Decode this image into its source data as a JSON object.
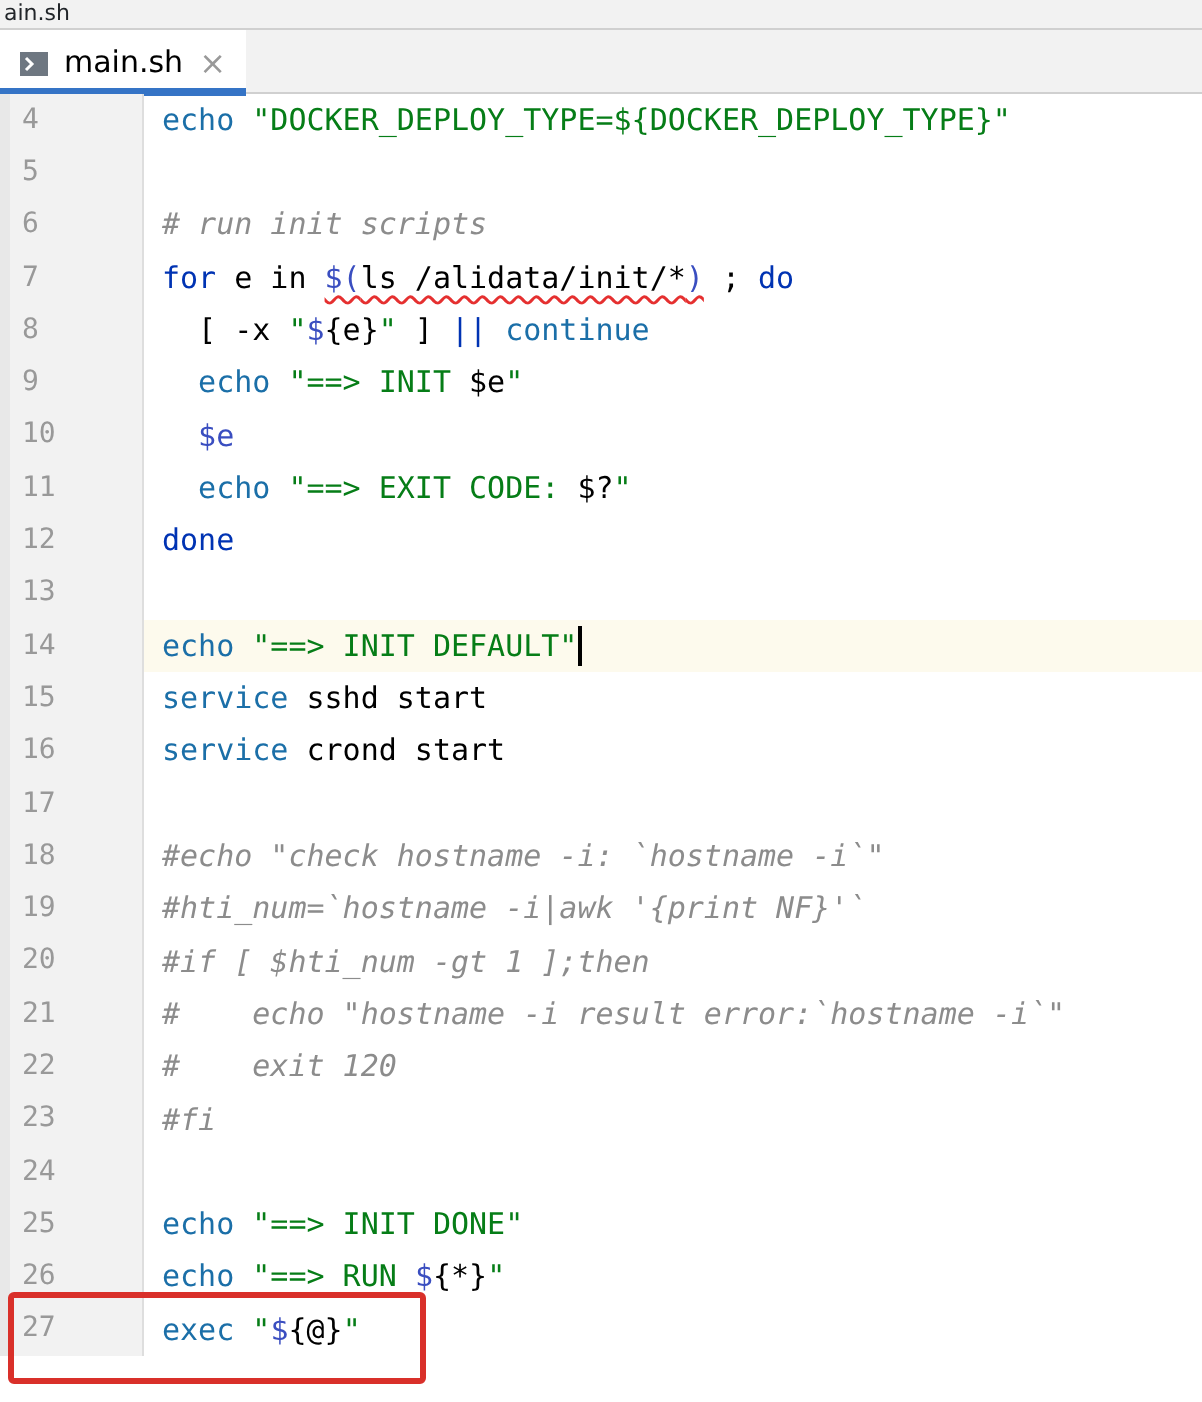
{
  "window": {
    "title": "ain.sh"
  },
  "tabs": [
    {
      "label": "main.sh",
      "selected": true,
      "close": "×"
    }
  ],
  "editor": {
    "lines": [
      {
        "number": "4",
        "tokens": [
          {
            "kind": "command",
            "text": "echo"
          },
          {
            "kind": "string",
            "text": " \"DOCKER_DEPLOY_TYPE=${DOCKER_DEPLOY_TYPE}\""
          }
        ]
      },
      {
        "number": "5"
      },
      {
        "number": "6",
        "tokens": [
          {
            "kind": "comment",
            "text": "# run init scripts"
          }
        ]
      },
      {
        "number": "7",
        "tokens": [
          {
            "kind": "keyword",
            "text": "for"
          },
          {
            "kind": "plain",
            "text": " e in "
          },
          {
            "kind": "subst",
            "text": "$(ls /alidata/init/*)",
            "underline": true
          },
          {
            "kind": "plain",
            "text": " ; "
          },
          {
            "kind": "keyword",
            "text": "do"
          }
        ]
      },
      {
        "number": "8",
        "indented": true,
        "tokens": [
          {
            "kind": "plain",
            "text": "[ -x "
          },
          {
            "kind": "string",
            "text": "\""
          },
          {
            "kind": "variable",
            "text": "$"
          },
          {
            "kind": "plain",
            "text": "{e}"
          },
          {
            "kind": "string",
            "text": "\""
          },
          {
            "kind": "plain",
            "text": " ] "
          },
          {
            "kind": "keyword",
            "text": "||"
          },
          {
            "kind": "command",
            "text": " continue"
          }
        ]
      },
      {
        "number": "9",
        "indented": true,
        "tokens": [
          {
            "kind": "command",
            "text": "echo"
          },
          {
            "kind": "string",
            "text": " \"==> INIT "
          },
          {
            "kind": "plain",
            "text": "$e"
          },
          {
            "kind": "string",
            "text": "\""
          }
        ]
      },
      {
        "number": "10",
        "indented": true,
        "tokens": [
          {
            "kind": "variable",
            "text": "$e"
          }
        ]
      },
      {
        "number": "11",
        "indented": true,
        "tokens": [
          {
            "kind": "command",
            "text": "echo"
          },
          {
            "kind": "string",
            "text": " \"==> EXIT CODE: "
          },
          {
            "kind": "plain",
            "text": "$?"
          },
          {
            "kind": "string",
            "text": "\""
          }
        ]
      },
      {
        "number": "12",
        "tokens": [
          {
            "kind": "keyword",
            "text": "done"
          }
        ]
      },
      {
        "number": "13"
      },
      {
        "number": "14",
        "current": true,
        "tokens": [
          {
            "kind": "command",
            "text": "echo"
          },
          {
            "kind": "string",
            "text": " \"==> INIT DEFAULT\""
          }
        ]
      },
      {
        "number": "15",
        "tokens": [
          {
            "kind": "command",
            "text": "service"
          },
          {
            "kind": "plain",
            "text": " sshd start"
          }
        ]
      },
      {
        "number": "16",
        "tokens": [
          {
            "kind": "command",
            "text": "service"
          },
          {
            "kind": "plain",
            "text": " crond start"
          }
        ]
      },
      {
        "number": "17"
      },
      {
        "number": "18",
        "tokens": [
          {
            "kind": "comment",
            "text": "#echo \"check hostname -i: `hostname -i`\""
          }
        ]
      },
      {
        "number": "19",
        "tokens": [
          {
            "kind": "comment",
            "text": "#hti_num=`hostname -i|awk '{print NF}'`"
          }
        ]
      },
      {
        "number": "20",
        "tokens": [
          {
            "kind": "comment",
            "text": "#if [ $hti_num -gt 1 ];then"
          }
        ]
      },
      {
        "number": "21",
        "tokens": [
          {
            "kind": "comment",
            "text": "#    echo \"hostname -i result error:`hostname -i`\""
          }
        ]
      },
      {
        "number": "22",
        "tokens": [
          {
            "kind": "comment",
            "text": "#    exit 120"
          }
        ]
      },
      {
        "number": "23",
        "tokens": [
          {
            "kind": "comment",
            "text": "#fi"
          }
        ]
      },
      {
        "number": "24"
      },
      {
        "number": "25",
        "tokens": [
          {
            "kind": "command",
            "text": "echo"
          },
          {
            "kind": "string",
            "text": " \"==> INIT DONE\""
          }
        ]
      },
      {
        "number": "26",
        "tokens": [
          {
            "kind": "command",
            "text": "echo"
          },
          {
            "kind": "string",
            "text": " \"==> RUN "
          },
          {
            "kind": "variable",
            "text": "$"
          },
          {
            "kind": "plain",
            "text": "{*}"
          },
          {
            "kind": "string",
            "text": "\""
          }
        ]
      },
      {
        "number": "27",
        "boxed": true,
        "tokens": [
          {
            "kind": "command",
            "text": "exec"
          },
          {
            "kind": "string",
            "text": " \""
          },
          {
            "kind": "variable",
            "text": "$"
          },
          {
            "kind": "plain",
            "text": "{@}"
          },
          {
            "kind": "string",
            "text": "\""
          }
        ]
      }
    ]
  }
}
